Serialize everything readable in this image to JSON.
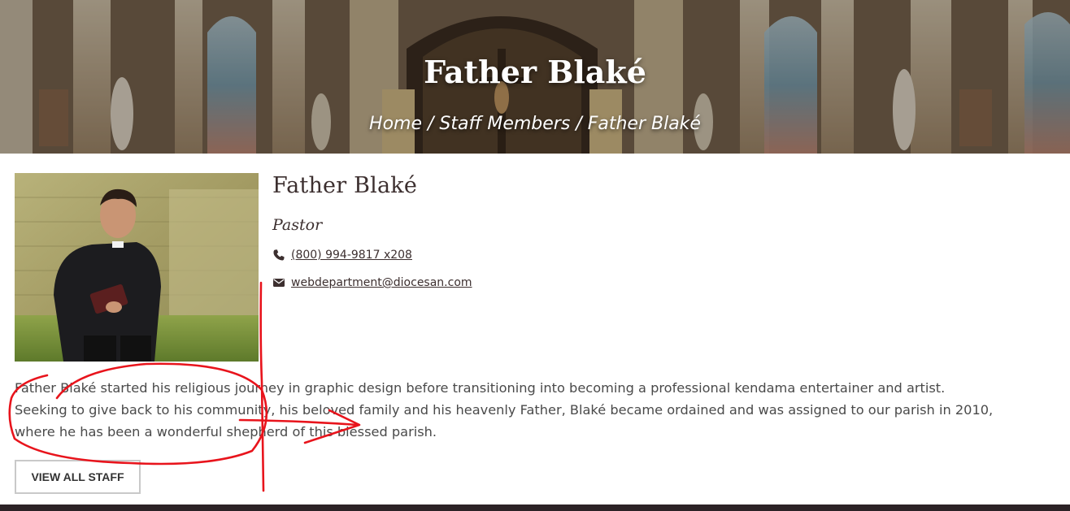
{
  "hero": {
    "title": "Father Blaké",
    "breadcrumb": {
      "home": "Home",
      "sep1": " / ",
      "staff": "Staff Members",
      "sep2": " / ",
      "current": "Father Blaké"
    }
  },
  "profile": {
    "name": "Father Blaké",
    "role": "Pastor",
    "phone": "(800) 994-9817 x208",
    "email": "webdepartment@diocesan.com",
    "phone_icon": "phone-icon",
    "email_icon": "envelope-icon"
  },
  "bio": {
    "line1": "Father Blaké started his religious journey in graphic design before transitioning into becoming a professional kendama entertainer and artist.",
    "line2": "Seeking to give back to his community, his beloved family and his heavenly Father, Blaké became ordained and was assigned to our parish in 2010,",
    "line3": "where he has been a wonderful shepherd of this blessed parish."
  },
  "actions": {
    "view_all_staff": "VIEW ALL STAFF"
  },
  "colors": {
    "text_dark": "#3c2f2f",
    "annotation_red": "#e8141c",
    "footer": "#2c2226"
  }
}
